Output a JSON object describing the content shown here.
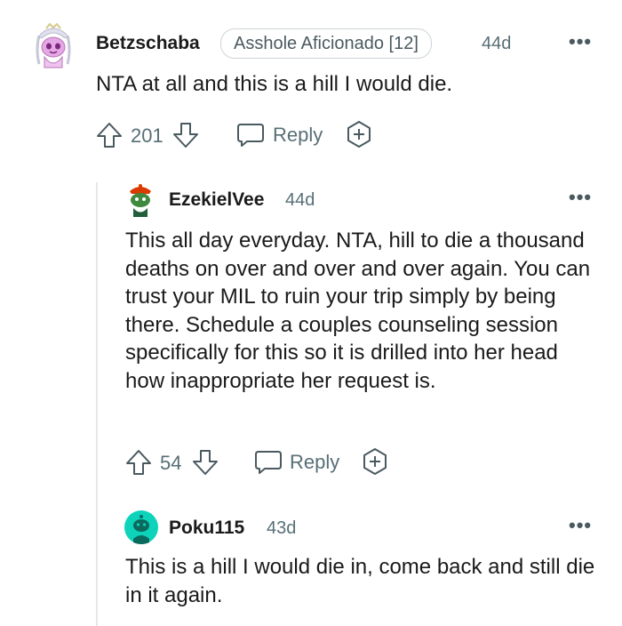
{
  "comments": [
    {
      "username": "Betzschaba",
      "flair": "Asshole Aficionado [12]",
      "age": "44d",
      "body": "NTA at all and this is a hill I would die.",
      "upvotes": "201",
      "reply_label": "Reply",
      "more_label": "•••",
      "avatar_icon": "avatar-snoo-pink-icon"
    },
    {
      "username": "EzekielVee",
      "age": "44d",
      "body": "This all day everyday. NTA, hill to die a thousand deaths on over and over and over again. You can trust your MIL to ruin your trip simply by being there. Schedule a couples counseling session specifically for this so it is drilled into her head how inappropriate her request is.",
      "upvotes": "54",
      "reply_label": "Reply",
      "more_label": "•••",
      "avatar_icon": "avatar-snoo-green-icon"
    },
    {
      "username": "Poku115",
      "age": "43d",
      "body": "This is a hill I would die in, come back and still die in it again.",
      "more_label": "•••",
      "avatar_icon": "avatar-default-teal-icon"
    }
  ],
  "colors": {
    "text": "#1a1a1b",
    "meta": "#576f76",
    "thread_line": "#e5e8ea",
    "teal_avatar": "#0dd3bb"
  }
}
